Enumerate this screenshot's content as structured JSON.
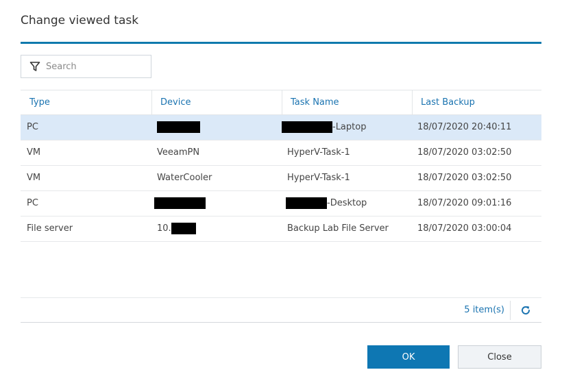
{
  "dialog": {
    "title": "Change viewed task"
  },
  "search": {
    "placeholder": "Search",
    "value": ""
  },
  "table": {
    "columns": [
      "Type",
      "Device",
      "Task Name",
      "Last Backup"
    ],
    "rows": [
      {
        "type": "PC",
        "device": "",
        "task_suffix": "-Laptop",
        "task": "",
        "last_backup": "18/07/2020 20:40:11",
        "selected": true
      },
      {
        "type": "VM",
        "device": "VeeamPN",
        "task_suffix": "",
        "task": "HyperV-Task-1",
        "last_backup": "18/07/2020 03:02:50",
        "selected": false
      },
      {
        "type": "VM",
        "device": "WaterCooler",
        "task_suffix": "",
        "task": "HyperV-Task-1",
        "last_backup": "18/07/2020 03:02:50",
        "selected": false
      },
      {
        "type": "PC",
        "device": "",
        "task_suffix": "-Desktop",
        "task": "",
        "last_backup": "18/07/2020 09:01:16",
        "selected": false
      },
      {
        "type": "File server",
        "device": "10.",
        "task_suffix": "",
        "task": "Backup Lab File Server",
        "last_backup": "18/07/2020 03:00:04",
        "selected": false
      }
    ]
  },
  "footer": {
    "item_count": "5 item(s)"
  },
  "buttons": {
    "ok": "OK",
    "close": "Close"
  },
  "icons": {
    "search": "filter-icon",
    "refresh": "refresh-icon"
  },
  "colors": {
    "accent": "#0f79ad",
    "link": "#1a73b0",
    "selected_row": "#dbe9f8"
  }
}
